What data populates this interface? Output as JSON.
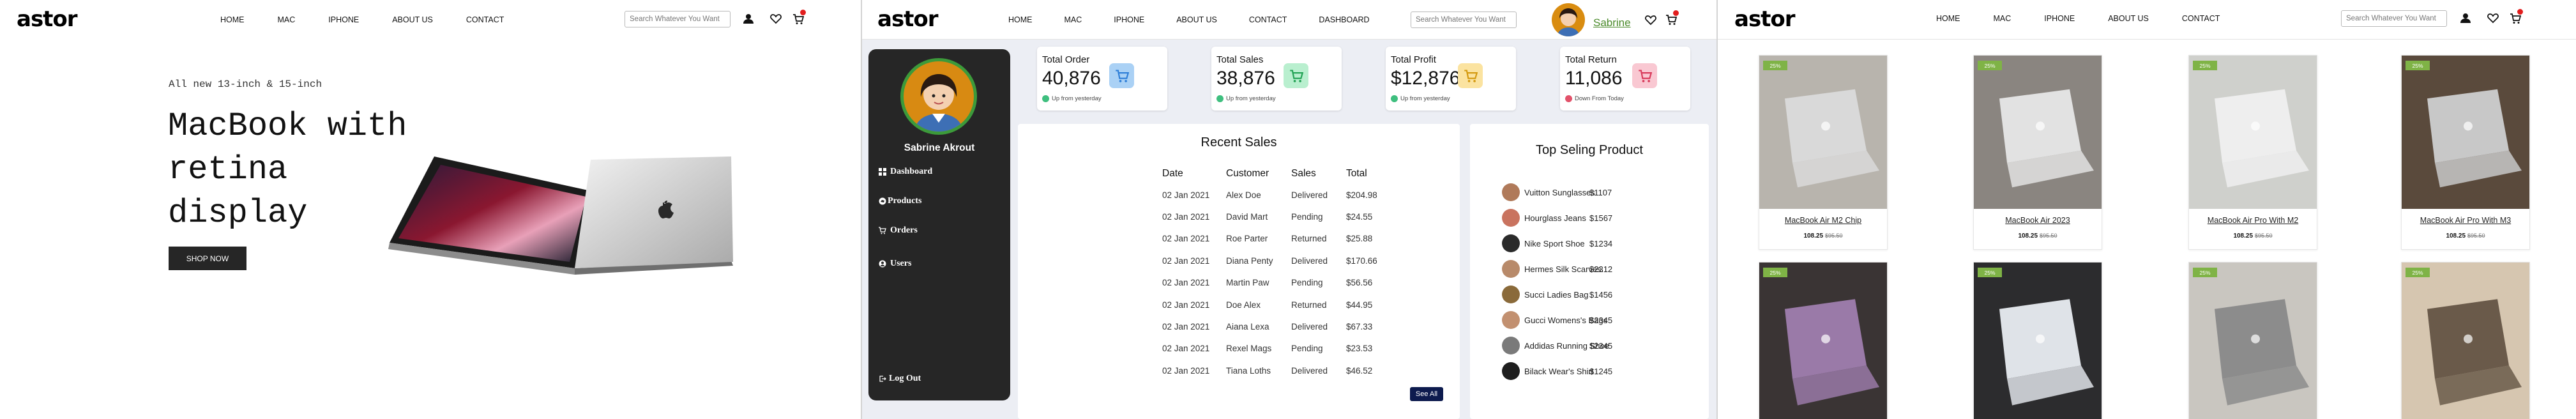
{
  "store": {
    "logo": "astor",
    "nav": [
      "HOME",
      "MAC",
      "IPHONE",
      "ABOUT US",
      "CONTACT"
    ],
    "nav_dashboard": [
      "HOME",
      "MAC",
      "IPHONE",
      "ABOUT US",
      "CONTACT",
      "DASHBOARD"
    ],
    "search_placeholder": "Search Whatever You Want",
    "cart_count": "0"
  },
  "hero": {
    "subtitle": "All new 13-inch & 15-inch",
    "title": "MacBook with retina display",
    "button": "SHOP NOW"
  },
  "dashboard": {
    "user_name": "Sabrine",
    "sidebar": {
      "profile_name": "Sabrine Akrout",
      "items": [
        "Dashboard",
        "Products",
        "Orders",
        "Users"
      ],
      "logout": "Log Out"
    },
    "cards": [
      {
        "label": "Total Order",
        "value": "40,876",
        "trend": "Up from yesterday",
        "color": "#aad1f5",
        "icon_color": "#2f7fd8",
        "trend_color": "#3fbf7f"
      },
      {
        "label": "Total Sales",
        "value": "38,876",
        "trend": "Up from yesterday",
        "color": "#b9efcf",
        "icon_color": "#24a356",
        "trend_color": "#3fbf7f"
      },
      {
        "label": "Total Profit",
        "value": "$12,876",
        "trend": "Up from yesterday",
        "color": "#fbe3a0",
        "icon_color": "#d49a10",
        "trend_color": "#3fbf7f"
      },
      {
        "label": "Total Return",
        "value": "11,086",
        "trend": "Down From Today",
        "color": "#f9c8d2",
        "icon_color": "#d83a5a",
        "trend_color": "#e2526a"
      }
    ],
    "recent_sales": {
      "title": "Recent Sales",
      "columns": [
        "Date",
        "Customer",
        "Sales",
        "Total"
      ],
      "rows": [
        [
          "02 Jan 2021",
          "Alex Doe",
          "Delivered",
          "$204.98"
        ],
        [
          "02 Jan 2021",
          "David Mart",
          "Pending",
          "$24.55"
        ],
        [
          "02 Jan 2021",
          "Roe Parter",
          "Returned",
          "$25.88"
        ],
        [
          "02 Jan 2021",
          "Diana Penty",
          "Delivered",
          "$170.66"
        ],
        [
          "02 Jan 2021",
          "Martin Paw",
          "Pending",
          "$56.56"
        ],
        [
          "02 Jan 2021",
          "Doe Alex",
          "Returned",
          "$44.95"
        ],
        [
          "02 Jan 2021",
          "Aiana Lexa",
          "Delivered",
          "$67.33"
        ],
        [
          "02 Jan 2021",
          "Rexel Mags",
          "Pending",
          "$23.53"
        ],
        [
          "02 Jan 2021",
          "Tiana Loths",
          "Delivered",
          "$46.52"
        ]
      ],
      "see_all": "See All"
    },
    "top_products": {
      "title": "Top Seling Product",
      "items": [
        {
          "name": "Vuitton Sunglasses",
          "price": "$1107",
          "color": "#b07a5a"
        },
        {
          "name": "Hourglass Jeans",
          "price": "$1567",
          "color": "#c9735f"
        },
        {
          "name": "Nike Sport Shoe",
          "price": "$1234",
          "color": "#2a2a2a"
        },
        {
          "name": "Hermes Silk Scarves.",
          "price": "$2312",
          "color": "#b88a6a"
        },
        {
          "name": "Succi Ladies Bag",
          "price": "$1456",
          "color": "#8a6a3a"
        },
        {
          "name": "Gucci Womens's Bags",
          "price": "$2345",
          "color": "#c29070"
        },
        {
          "name": "Addidas Running Shoe",
          "price": "$2345",
          "color": "#7a7a7a"
        },
        {
          "name": "Bilack Wear's Shirt",
          "price": "$1245",
          "color": "#1e1e1e"
        }
      ]
    }
  },
  "products": {
    "row1": [
      {
        "tag": "25%",
        "name": "MacBook Air M2 Chip",
        "price": "108.25",
        "old_price": "$95.50",
        "bg": "#b8b4ad",
        "device": "#d9d9d9"
      },
      {
        "tag": "25%",
        "name": "MacBook Air 2023",
        "price": "108.25",
        "old_price": "$95.50",
        "bg": "#8a8580",
        "device": "#e2e2e2"
      },
      {
        "tag": "25%",
        "name": "MacBook Air Pro With M2",
        "price": "108.25",
        "old_price": "$95.50",
        "bg": "#cfd0cc",
        "device": "#eeeeee"
      },
      {
        "tag": "25%",
        "name": "MacBook Air Pro With M3",
        "price": "108.25",
        "old_price": "$95.50",
        "bg": "#5a4a3c",
        "device": "#c8c8c8"
      }
    ],
    "row2": [
      {
        "tag": "25%",
        "bg": "#3a3434",
        "device": "#9a7aa8"
      },
      {
        "tag": "25%",
        "bg": "#2c2c2e",
        "device": "#dfe3e8"
      },
      {
        "tag": "25%",
        "bg": "#c9c6c0",
        "device": "#8c8c8c"
      },
      {
        "tag": "25%",
        "bg": "#d6c6b0",
        "device": "#6a5a4a"
      }
    ]
  }
}
